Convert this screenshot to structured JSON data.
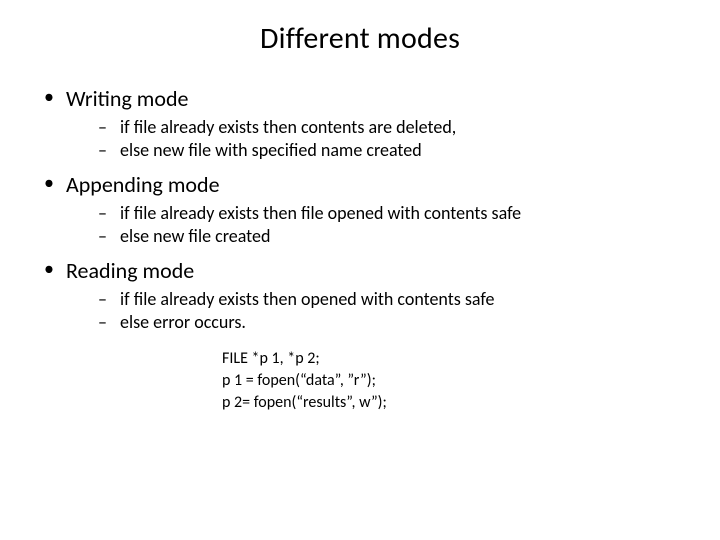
{
  "title": "Different modes",
  "sections": [
    {
      "heading": "Writing mode",
      "points": [
        "if file already exists then contents are deleted,",
        "else new file with specified name created"
      ]
    },
    {
      "heading": "Appending mode",
      "points": [
        "if file already exists then file opened with contents safe",
        "else new file created"
      ]
    },
    {
      "heading": "Reading mode",
      "points": [
        "if file already exists then opened with contents safe",
        "else error occurs."
      ]
    }
  ],
  "code": [
    "FILE *p 1, *p 2;",
    "p 1 = fopen(“data”, ”r”);",
    "p 2= fopen(“results”, w”);"
  ]
}
